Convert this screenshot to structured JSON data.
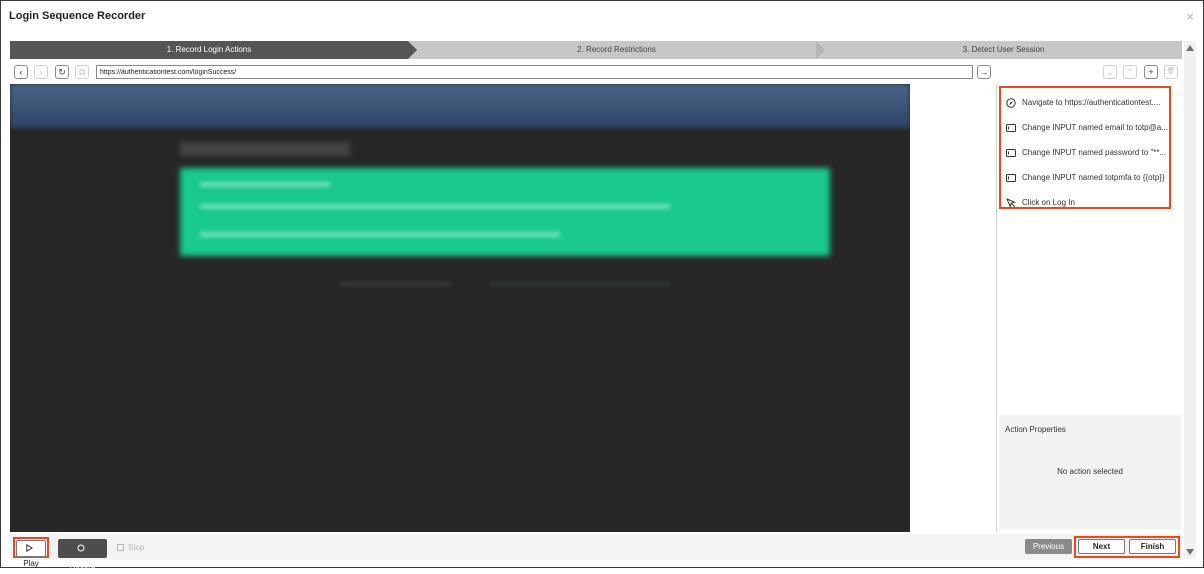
{
  "window": {
    "title": "Login Sequence Recorder",
    "close_glyph": "×"
  },
  "steps": [
    {
      "label": "1. Record Login Actions",
      "active": true
    },
    {
      "label": "2. Record Restrictions",
      "active": false
    },
    {
      "label": "3. Detect User Session",
      "active": false
    }
  ],
  "toolbar": {
    "back_glyph": "‹",
    "forward_glyph": "›",
    "reload_glyph": "↻",
    "copy_glyph": "⧉",
    "url": "https://authenticationtest.com/loginSuccess/",
    "go_glyph": "→",
    "move_down_glyph": "⌄",
    "move_up_glyph": "⌃",
    "add_glyph": "+",
    "delete_glyph": "🗑"
  },
  "actions": [
    {
      "icon": "compass-icon",
      "text": "Navigate to https://authenticationtest...."
    },
    {
      "icon": "input-icon",
      "text": "Change INPUT named email to totp@a..."
    },
    {
      "icon": "input-icon",
      "text": "Change INPUT named password to \"**..."
    },
    {
      "icon": "input-icon",
      "text": "Change INPUT named totpmfa to {{otp}}"
    },
    {
      "icon": "cursor-icon",
      "text": "Click on Log In"
    }
  ],
  "properties": {
    "title": "Action Properties",
    "empty": "No action selected"
  },
  "bottom": {
    "play": "Play",
    "record": "Record",
    "stop": "Stop",
    "previous": "Previous",
    "next": "Next",
    "finish": "Finish"
  },
  "colors": {
    "highlight": "#e84a1f",
    "accent_green": "#19c98d",
    "active_step": "#555555"
  }
}
